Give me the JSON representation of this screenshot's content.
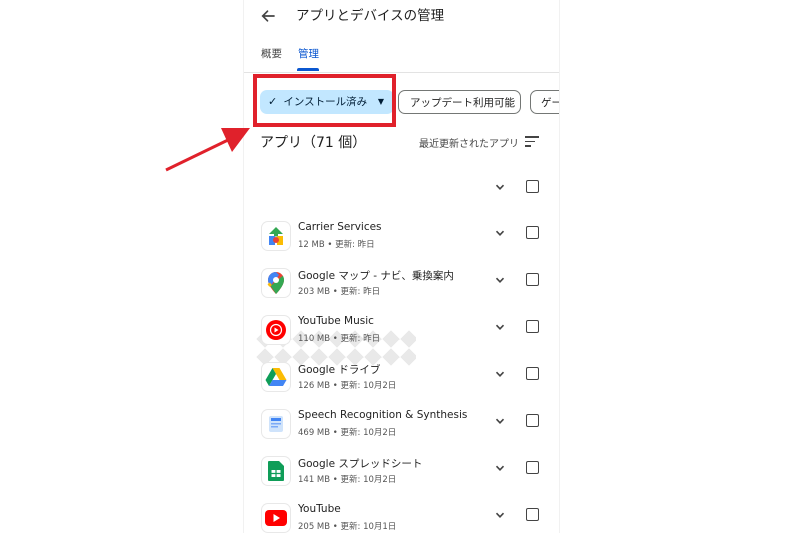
{
  "header": {
    "back_icon": "arrow-back-icon",
    "title": "アプリとデバイスの管理"
  },
  "tabs": [
    {
      "label": "概要",
      "selected": false
    },
    {
      "label": "管理",
      "selected": true
    }
  ],
  "filters": {
    "installed": "インストール済み",
    "updates": "アップデート利用可能",
    "games": "ゲー"
  },
  "list_header": {
    "title": "アプリ（71 個）",
    "sort_label": "最近更新されたアプリ"
  },
  "apps": [
    {
      "name": "Carrier Services",
      "size": "12 MB",
      "updated": "更新: 昨日",
      "icon": "carrier-services-icon"
    },
    {
      "name": "Google マップ - ナビ、乗換案内",
      "size": "203 MB",
      "updated": "更新: 昨日",
      "icon": "google-maps-icon"
    },
    {
      "name": "YouTube Music",
      "size": "110 MB",
      "updated": "更新: 昨日",
      "icon": "youtube-music-icon"
    },
    {
      "name": "Google ドライブ",
      "size": "126 MB",
      "updated": "更新: 10月2日",
      "icon": "google-drive-icon"
    },
    {
      "name": "Speech Recognition & Synthesis",
      "size": "469 MB",
      "updated": "更新: 10月2日",
      "icon": "speech-recognition-icon"
    },
    {
      "name": "Google スプレッドシート",
      "size": "141 MB",
      "updated": "更新: 10月2日",
      "icon": "google-sheets-icon"
    },
    {
      "name": "YouTube",
      "size": "205 MB",
      "updated": "更新: 10月1日",
      "icon": "youtube-icon"
    }
  ],
  "colors": {
    "accent": "#0b57d0",
    "chip_selected": "#c2e7ff",
    "annotation_red": "#e0212b"
  }
}
